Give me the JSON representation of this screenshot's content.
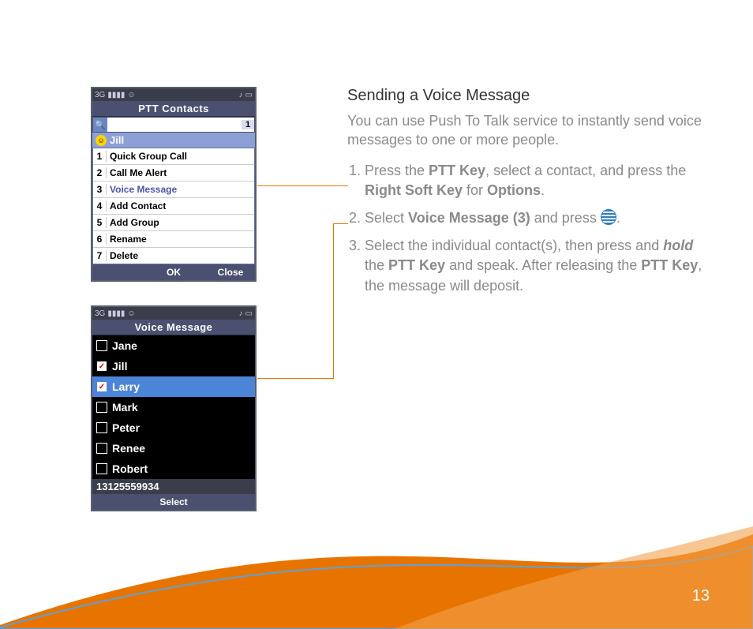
{
  "pageNumber": "13",
  "instructions": {
    "heading": "Sending a Voice Message",
    "intro": "You can use Push To Talk service to instantly send voice messages to one or more people.",
    "step1_pre": "Press the ",
    "step1_b1": "PTT Key",
    "step1_mid": ", select a contact, and press the ",
    "step1_b2": "Right Soft Key",
    "step1_mid2": " for ",
    "step1_b3": "Options",
    "step1_end": ".",
    "step2_pre": "Select ",
    "step2_b1": "Voice Message (3)",
    "step2_mid": " and press ",
    "step2_end": ".",
    "step3_pre": "Select the individual contact(s), then press and ",
    "step3_em": "hold",
    "step3_mid": " the ",
    "step3_b1": "PTT Key",
    "step3_mid2": " and speak. After releasing the ",
    "step3_b2": "PTT Key",
    "step3_end": ", the message will deposit."
  },
  "phone1": {
    "title": "PTT Contacts",
    "searchCount": "1",
    "contactName": "Jill",
    "menu": [
      {
        "n": "1",
        "l": "Quick Group Call"
      },
      {
        "n": "2",
        "l": "Call Me Alert"
      },
      {
        "n": "3",
        "l": "Voice Message"
      },
      {
        "n": "4",
        "l": "Add Contact"
      },
      {
        "n": "5",
        "l": "Add Group"
      },
      {
        "n": "6",
        "l": "Rename"
      },
      {
        "n": "7",
        "l": "Delete"
      }
    ],
    "softLeft": "",
    "softMid": "OK",
    "softRight": "Close"
  },
  "phone2": {
    "title": "Voice Message",
    "contacts": [
      "Jane",
      "Jill",
      "Larry",
      "Mark",
      "Peter",
      "Renee",
      "Robert"
    ],
    "selectedIndex": 2,
    "checkedIndex": 1,
    "phoneNumber": "13125559934",
    "softMid": "Select"
  },
  "status": {
    "sig": "3G",
    "bars": "▮▮▮▮",
    "smile": "☺",
    "music": "♪",
    "batt": "▭"
  }
}
